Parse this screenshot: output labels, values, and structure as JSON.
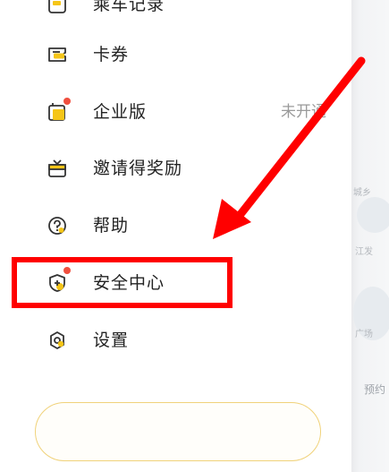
{
  "drawer": {
    "items": [
      {
        "label": "乘车记录",
        "icon": "record-icon"
      },
      {
        "label": "卡券",
        "icon": "ticket-icon"
      },
      {
        "label": "企业版",
        "icon": "business-icon",
        "value": "未开通",
        "dot": true
      },
      {
        "label": "邀请得奖励",
        "icon": "gift-icon"
      },
      {
        "label": "帮助",
        "icon": "help-icon"
      },
      {
        "label": "安全中心",
        "icon": "shield-icon",
        "dot": true
      },
      {
        "label": "设置",
        "icon": "settings-icon"
      }
    ]
  },
  "annotation": {
    "highlight_color": "#ff0000",
    "arrow_color": "#ff0000",
    "highlighted_item": "安全中心"
  },
  "map_background": {
    "labels": [
      "城乡",
      "江发",
      "广场",
      "预约"
    ]
  },
  "colors": {
    "accent_yellow": "#f5c518",
    "notification_dot": "#f04f3e",
    "text_primary": "#222222",
    "text_secondary": "#9a9a9a"
  }
}
